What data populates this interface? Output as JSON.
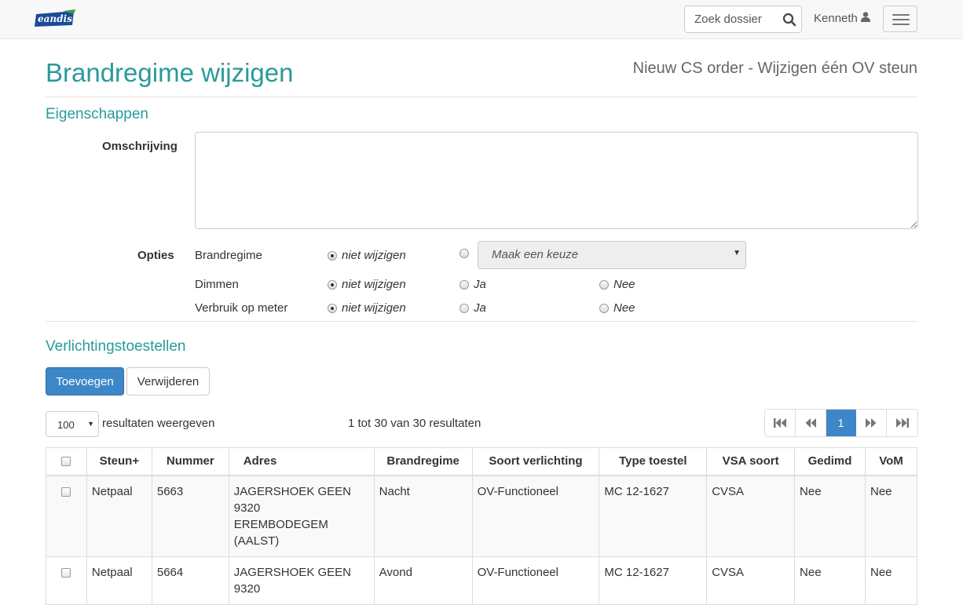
{
  "navbar": {
    "logo_text": "eandis",
    "search_placeholder": "Zoek dossier",
    "user_name": "Kenneth"
  },
  "header": {
    "title": "Brandregime wijzigen",
    "subtitle": "Nieuw CS order - Wijzigen één OV steun"
  },
  "eigenschappen": {
    "title": "Eigenschappen",
    "omschrijving_label": "Omschrijving",
    "omschrijving_value": "",
    "opties_label": "Opties",
    "brandregime": {
      "label": "Brandregime",
      "opt_niet": "niet wijzigen",
      "select_placeholder": "Maak een keuze"
    },
    "dimmen": {
      "label": "Dimmen",
      "opt_niet": "niet wijzigen",
      "opt_ja": "Ja",
      "opt_nee": "Nee"
    },
    "verbruik": {
      "label": "Verbruik op meter",
      "opt_niet": "niet wijzigen",
      "opt_ja": "Ja",
      "opt_nee": "Nee"
    }
  },
  "verlichting": {
    "title": "Verlichtingstoestellen",
    "add_label": "Toevoegen",
    "remove_label": "Verwijderen",
    "page_length": "100",
    "page_length_text": "resultaten weergeven",
    "info": "1 tot 30 van 30 resultaten",
    "current_page": "1",
    "columns": [
      "Steun+",
      "Nummer",
      "Adres",
      "Brandregime",
      "Soort verlichting",
      "Type toestel",
      "VSA soort",
      "Gedimd",
      "VoM"
    ],
    "rows": [
      {
        "steun": "Netpaal",
        "nummer": "5663",
        "adres_1": "JAGERSHOEK GEEN 9320",
        "adres_2": "EREMBODEGEM (AALST)",
        "brandregime": "Nacht",
        "soort": "OV-Functioneel",
        "type": "MC 12-1627",
        "vsa": "CVSA",
        "gedimd": "Nee",
        "vom": "Nee"
      },
      {
        "steun": "Netpaal",
        "nummer": "5664",
        "adres_1": "JAGERSHOEK GEEN 9320",
        "adres_2": "",
        "brandregime": "Avond",
        "soort": "OV-Functioneel",
        "type": "MC 12-1627",
        "vsa": "CVSA",
        "gedimd": "Nee",
        "vom": "Nee"
      }
    ]
  },
  "colors": {
    "accent": "#2a9a9a",
    "primary": "#3d87c8",
    "logo_blue": "#1a4a9a",
    "logo_green": "#2ea043"
  }
}
